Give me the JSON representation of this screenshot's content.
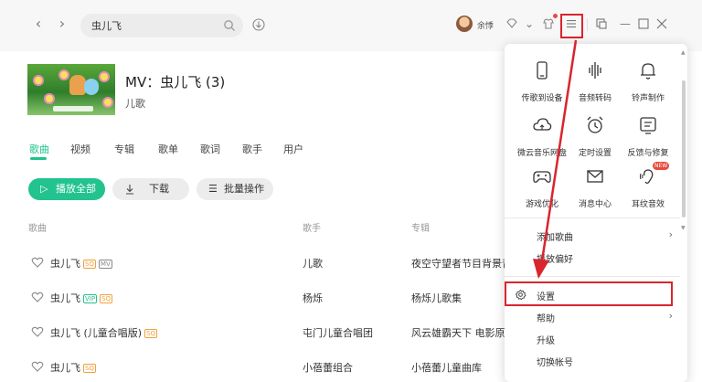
{
  "topbar": {
    "search_value": "虫儿飞",
    "username": "余悸",
    "back_icon": "chevron-left-icon",
    "forward_icon": "chevron-right-icon"
  },
  "mv": {
    "title": "MV：虫儿飞 (3)",
    "artist": "儿歌"
  },
  "tabs": [
    {
      "label": "歌曲",
      "active": true
    },
    {
      "label": "视频"
    },
    {
      "label": "专辑"
    },
    {
      "label": "歌单"
    },
    {
      "label": "歌词"
    },
    {
      "label": "歌手"
    },
    {
      "label": "用户"
    }
  ],
  "actions": {
    "play_all": "播放全部",
    "download": "下载",
    "batch": "批量操作"
  },
  "table": {
    "headers": {
      "song": "歌曲",
      "artist": "歌手",
      "album": "专辑"
    },
    "rows": [
      {
        "song": "虫儿飞",
        "badges": [
          "SQ",
          "MV"
        ],
        "artist": "儿歌",
        "album": "夜空守望者节目背景音乐"
      },
      {
        "song": "虫儿飞",
        "badges": [
          "VIP",
          "SQ"
        ],
        "artist": "杨烁",
        "album": "杨烁儿歌集"
      },
      {
        "song": "虫儿飞 (儿童合唱版)",
        "badges": [
          "SQ"
        ],
        "artist": "屯门儿童合唱团",
        "album": "风云雄霸天下 电影原声"
      },
      {
        "song": "虫儿飞",
        "badges": [
          "SQ"
        ],
        "artist": "小蓓蕾组合",
        "album": "小蓓蕾儿童曲库"
      }
    ]
  },
  "menu": {
    "grid": [
      {
        "label": "传歌到设备",
        "icon": "phone-icon"
      },
      {
        "label": "音频转码",
        "icon": "audio-wave-icon"
      },
      {
        "label": "铃声制作",
        "icon": "bell-icon"
      },
      {
        "label": "微云音乐网盘",
        "icon": "cloud-icon"
      },
      {
        "label": "定时设置",
        "icon": "alarm-clock-icon"
      },
      {
        "label": "反馈与修复",
        "icon": "feedback-icon"
      },
      {
        "label": "游戏优化",
        "icon": "gamepad-icon"
      },
      {
        "label": "消息中心",
        "icon": "mail-icon"
      },
      {
        "label": "耳纹音效",
        "icon": "ear-icon"
      }
    ],
    "new_badge": "NEW",
    "items": [
      {
        "label": "添加歌曲",
        "submenu": true
      },
      {
        "label": "播放偏好",
        "submenu": false
      },
      {
        "label": "设置",
        "submenu": false
      },
      {
        "label": "帮助",
        "submenu": true
      },
      {
        "label": "升级",
        "submenu": false
      },
      {
        "label": "切换帐号",
        "submenu": false
      }
    ]
  },
  "colors": {
    "accent": "#22c38e",
    "annotation": "#d9252e"
  }
}
